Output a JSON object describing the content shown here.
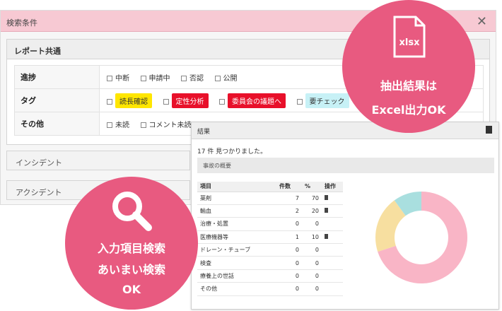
{
  "search": {
    "title": "検索条件",
    "close": "✕",
    "report_title": "レポート共通",
    "rows": [
      {
        "label": "進捗",
        "options": [
          "中断",
          "申請中",
          "否認",
          "公開"
        ]
      },
      {
        "label": "タグ",
        "tags": [
          "読長確認",
          "定性分析",
          "委員会の議題へ",
          "要チェック"
        ]
      },
      {
        "label": "その他",
        "options": [
          "未読",
          "コメント未読"
        ]
      }
    ],
    "panels": [
      "インシデント",
      "アクシデント"
    ]
  },
  "results": {
    "title": "結果",
    "count_text": "17 件 見つかりました。",
    "summary_label": "事故の概要",
    "columns": [
      "項目",
      "件数",
      "%",
      "操作"
    ],
    "rows": [
      {
        "item": "薬剤",
        "count": "7",
        "pct": "70",
        "icon": true
      },
      {
        "item": "輸血",
        "count": "2",
        "pct": "20",
        "icon": true
      },
      {
        "item": "治療・処置",
        "count": "0",
        "pct": "0",
        "icon": false
      },
      {
        "item": "医療機器等",
        "count": "1",
        "pct": "10",
        "icon": true
      },
      {
        "item": "ドレーン・チューブ",
        "count": "0",
        "pct": "0",
        "icon": false
      },
      {
        "item": "検査",
        "count": "0",
        "pct": "0",
        "icon": false
      },
      {
        "item": "療養上の世話",
        "count": "0",
        "pct": "0",
        "icon": false
      },
      {
        "item": "その他",
        "count": "0",
        "pct": "0",
        "icon": false
      }
    ]
  },
  "chart_data": {
    "type": "pie",
    "categories": [
      "薬剤",
      "輸血",
      "医療機器等"
    ],
    "values": [
      70,
      20,
      10
    ],
    "colors": [
      "#f9b5c6",
      "#f7dfa0",
      "#a9dfdf"
    ]
  },
  "promo": {
    "xlsx_label": "xlsx",
    "export_line1": "抽出結果は",
    "export_line2": "Excel出力OK",
    "search_line1": "入力項目検索",
    "search_line2": "あいまい検索",
    "search_line3": "OK"
  },
  "colors": {
    "bubble": "#e85a80",
    "header_pink": "#f7c9d3"
  }
}
